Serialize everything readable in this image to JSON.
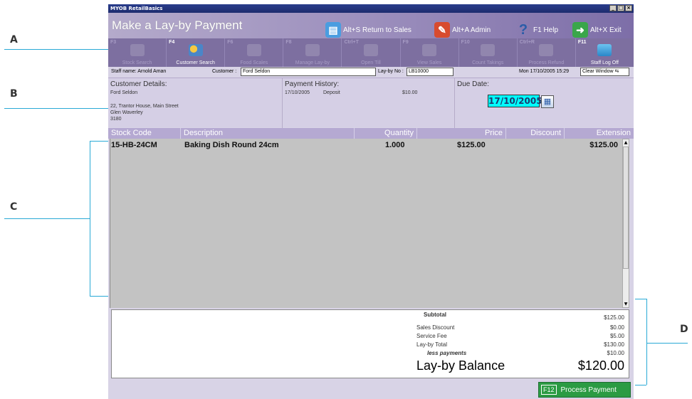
{
  "callouts": {
    "a": "A",
    "b": "B",
    "c": "C",
    "d": "D"
  },
  "window": {
    "app_title": "MYOB RetailBasics",
    "page_title": "Make a Lay-by Payment"
  },
  "header_actions": [
    {
      "label": "Alt+S Return to Sales",
      "icon": "return-to-sales-icon"
    },
    {
      "label": "Alt+A Admin",
      "icon": "admin-icon"
    },
    {
      "label": "F1 Help",
      "icon": "help-icon"
    },
    {
      "label": "Alt+X Exit",
      "icon": "exit-icon"
    }
  ],
  "toolbar": [
    {
      "key": "F3",
      "label": "Stock Search",
      "enabled": false
    },
    {
      "key": "F4",
      "label": "Customer Search",
      "enabled": true
    },
    {
      "key": "F6",
      "label": "Food Scales",
      "enabled": false
    },
    {
      "key": "F8",
      "label": "Manage Lay-by",
      "enabled": false
    },
    {
      "key": "Ctrl+T",
      "label": "Open Till",
      "enabled": false
    },
    {
      "key": "F9",
      "label": "View Sales",
      "enabled": false
    },
    {
      "key": "F10",
      "label": "Count Takings",
      "enabled": false
    },
    {
      "key": "Ctrl+R",
      "label": "Process Refund",
      "enabled": false
    },
    {
      "key": "F11",
      "label": "Staff Log Off",
      "enabled": true
    }
  ],
  "infobar": {
    "staff": "Staff name: Arnold Aman",
    "customer_label": "Customer :",
    "customer_value": "Ford Seldon",
    "layby_label": "Lay-by No :",
    "layby_value": "LB10000",
    "datetime": "Mon 17/10/2005 15:29",
    "clear": "Clear Window"
  },
  "details": {
    "customer_header": "Customer Details:",
    "customer_name": "Ford Seldon",
    "address1": "22, Trantor House, Main Street",
    "address2": "Glen Waverley",
    "address3": "3180",
    "history_header": "Payment History:",
    "history": [
      {
        "date": "17/10/2005",
        "type": "Deposit",
        "amount": "$10.00"
      }
    ],
    "due_header": "Due Date:",
    "due_date": "17/10/2005"
  },
  "table": {
    "columns": [
      "Stock Code",
      "Description",
      "Quantity",
      "Price",
      "Discount",
      "Extension"
    ],
    "rows": [
      {
        "code": "15-HB-24CM",
        "desc": "Baking Dish Round 24cm",
        "qty": "1.000",
        "price": "$125.00",
        "discount": "",
        "ext": "$125.00"
      }
    ]
  },
  "totals": {
    "subtotal_label": "Subtotal",
    "subtotal": "$125.00",
    "discount_label": "Sales Discount",
    "discount": "$0.00",
    "fee_label": "Service Fee",
    "fee": "$5.00",
    "layby_total_label": "Lay-by Total",
    "layby_total": "$130.00",
    "less_label": "less payments",
    "less": "$10.00",
    "balance_label": "Lay-by Balance",
    "balance": "$120.00"
  },
  "process": {
    "key": "F12",
    "label": "Process Payment"
  },
  "colors": {
    "accent": "#7d6fa0",
    "header": "#9c8fbd",
    "due_bg": "#00ffff",
    "process": "#2b9b43"
  }
}
